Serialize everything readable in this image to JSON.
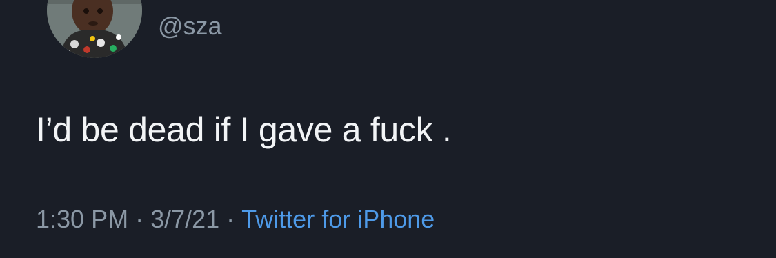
{
  "tweet": {
    "handle": "@sza",
    "text": "I’d be dead if I gave a fuck .",
    "time": "1:30 PM",
    "separator": "·",
    "date": "3/7/21",
    "source": "Twitter for iPhone"
  },
  "colors": {
    "background": "#1a1e27",
    "text_primary": "#f2f4f6",
    "text_secondary": "#8b98a5",
    "link": "#4e9ae8"
  }
}
